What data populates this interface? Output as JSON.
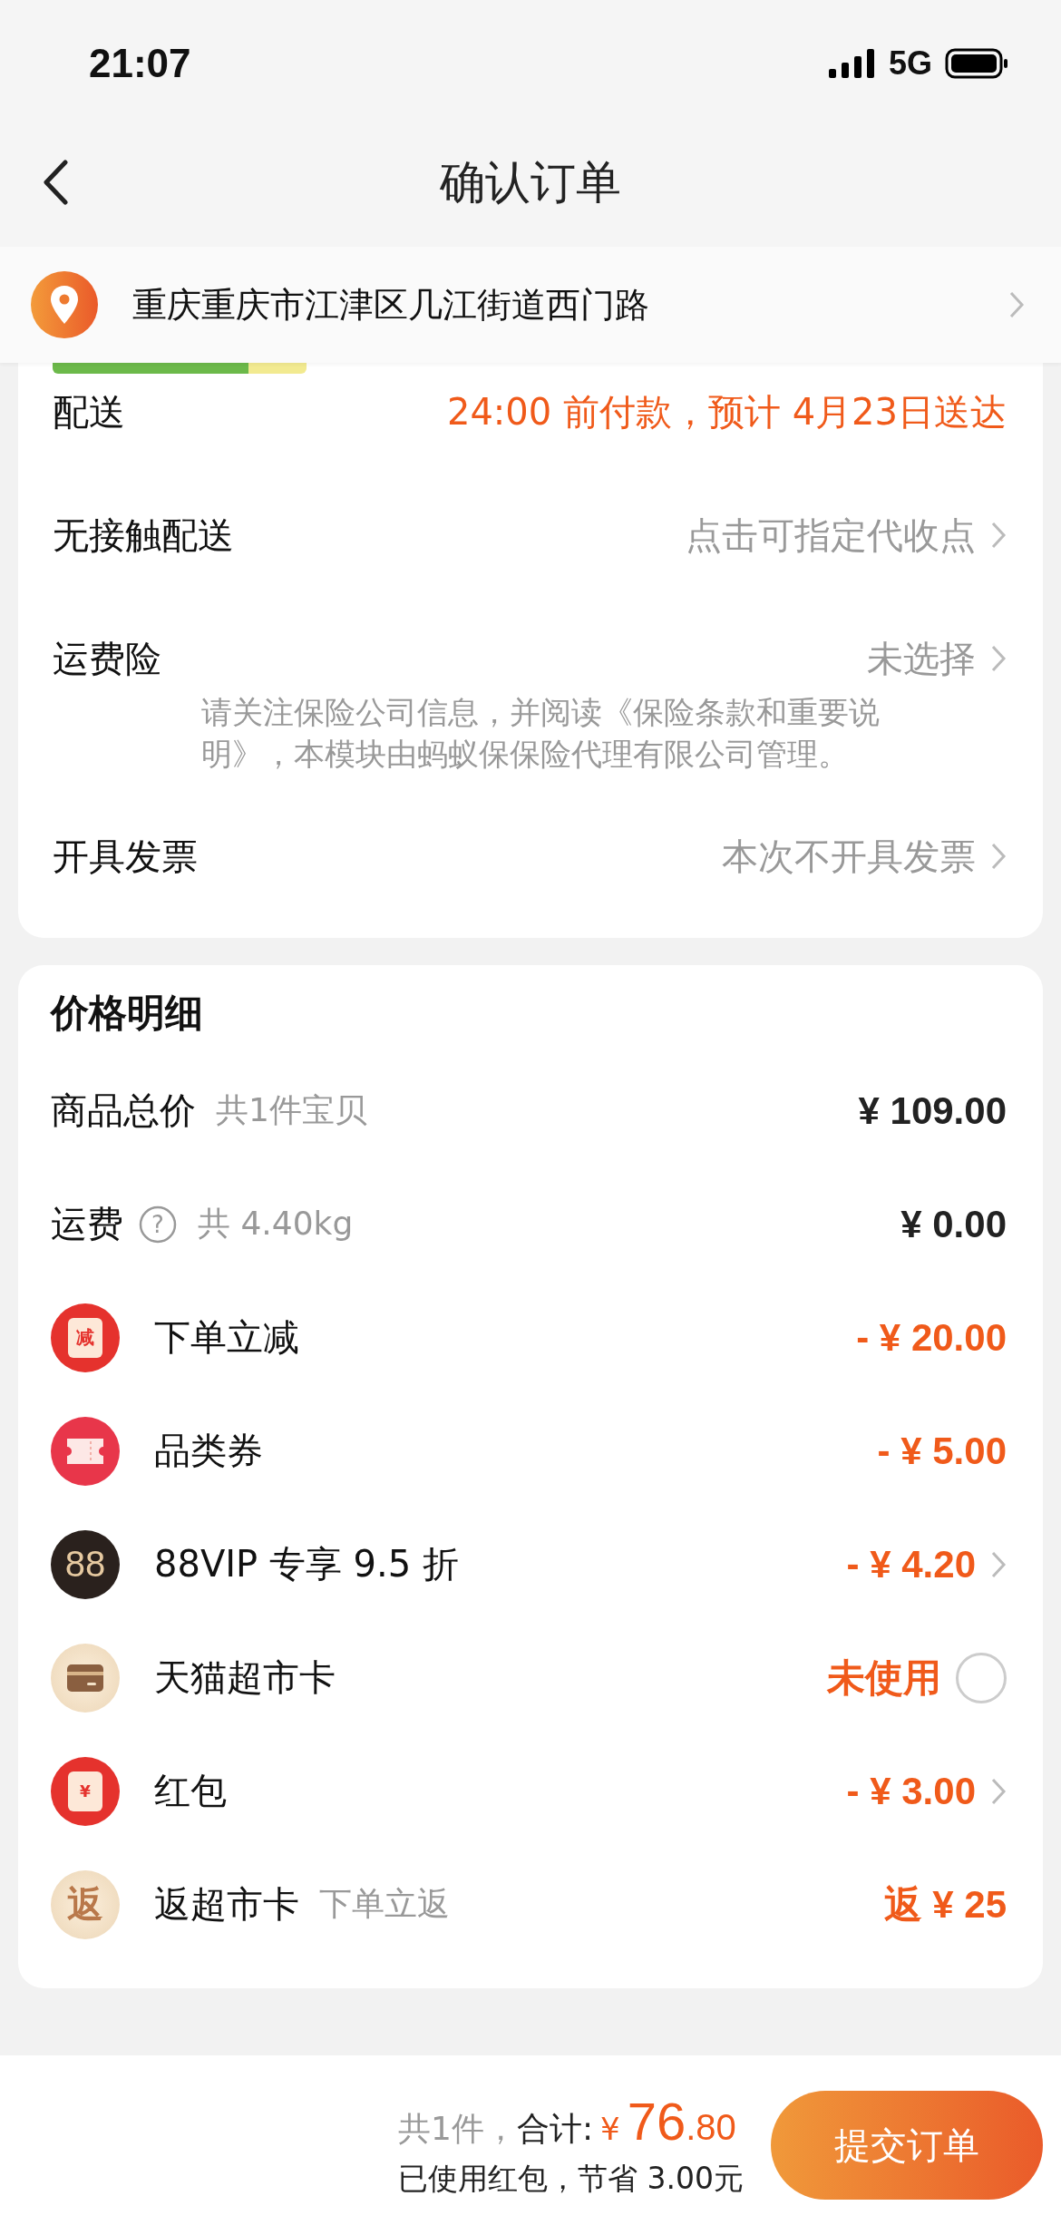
{
  "status_bar": {
    "time": "21:07",
    "network": "5G"
  },
  "nav": {
    "title": "确认订单"
  },
  "address": {
    "text": "重庆重庆市江津区几江街道西门路"
  },
  "delivery_rows": [
    {
      "label": "配送",
      "value": "24:00 前付款，预计 4月23日送达",
      "kind": "highlight"
    },
    {
      "label": "无接触配送",
      "value": "点击可指定代收点",
      "kind": "link"
    },
    {
      "label": "运费险",
      "value": "未选择",
      "kind": "link",
      "note": "请关注保险公司信息，并阅读《保险条款和重要说明》，本模块由蚂蚁保保险代理有限公司管理。"
    },
    {
      "label": "开具发票",
      "value": "本次不开具发票",
      "kind": "link"
    }
  ],
  "price": {
    "title": "价格明细",
    "rows": [
      {
        "kind": "plain",
        "label": "商品总价",
        "sublabel": "共1件宝贝",
        "amount": "¥ 109.00",
        "discount": false
      },
      {
        "kind": "plain",
        "label": "运费",
        "help_icon": "?",
        "sublabel": "共 4.40kg",
        "amount": "¥ 0.00",
        "discount": false
      },
      {
        "kind": "reduce",
        "label": "下单立减",
        "icon_text": "减",
        "amount": "- ¥ 20.00",
        "discount": true
      },
      {
        "kind": "ticket",
        "label": "品类券",
        "amount": "- ¥ 5.00",
        "discount": true
      },
      {
        "kind": "vip",
        "label": "88VIP 专享 9.5 折",
        "icon_text": "88",
        "amount": "- ¥ 4.20",
        "discount": true,
        "chevron": true
      },
      {
        "kind": "card",
        "label": "天猫超市卡",
        "amount": "未使用",
        "discount": true,
        "selected": false
      },
      {
        "kind": "redpacket",
        "label": "红包",
        "icon_text": "¥",
        "amount": "- ¥ 3.00",
        "discount": true,
        "chevron": true
      },
      {
        "kind": "return",
        "label": "返超市卡",
        "icon_text": "返",
        "sublabel": "下单立返",
        "amount": "返 ¥ 25",
        "discount": true
      }
    ]
  },
  "footer": {
    "count": "共1件，",
    "total_label": "合计:",
    "currency": "¥",
    "total_int": "76",
    "total_dec": ".80",
    "saving": "已使用红包，节省 3.00元",
    "submit": "提交订单"
  }
}
